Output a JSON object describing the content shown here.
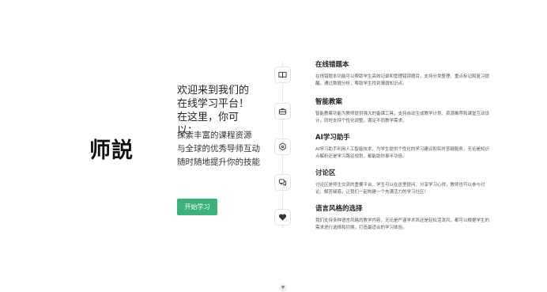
{
  "logo": {
    "text": "师説"
  },
  "welcome": {
    "heading": "欢迎来到我们的在线学习平台！在这里，你可以："
  },
  "features": [
    "探索丰富的课程资源",
    "与全球的优秀导师互动",
    "随时随地提升你的技能"
  ],
  "start_button": {
    "label": "开始学习",
    "color": "#3bb27a"
  },
  "timeline": {
    "icons": [
      "book-icon",
      "briefcase-icon",
      "ai-icon",
      "chat-icon",
      "heart-icon"
    ]
  },
  "sections": [
    {
      "title": "在线错题本",
      "desc": "在线错题本功能可以帮助学生高效记录和管理错误题目，支持分类整理、重点标记和复习提醒。通过数据分析，帮助学生找到薄弱知识点。"
    },
    {
      "title": "智能教案",
      "desc": "智能教案功能为教师提供强大的备课工具，支持自动生成教学计划、资源推荐和课堂互动设计，同时支持个性化调整，满足不同教学需求。"
    },
    {
      "title": "AI学习助手",
      "desc": "AI学习助手利用人工智能技术，为学生提供个性化的学习建议和实时答疑服务，无论是知识点解析还是学习路径规划，都能助你事半功倍。"
    },
    {
      "title": "讨论区",
      "desc": "讨论区是师生交流的重要平台，学生可以在这里提问、分享学习心得，教师也可以参与讨论，解答疑惑，让我们一起构建一个充满活力的学习社区！"
    },
    {
      "title": "语言风格的选择",
      "desc": "我们支持多种语言风格的教学内容，无论是严谨学术风还是轻松活泼风，都可以根据学生的需求进行选择和切换，打造最适合的学习体验。"
    }
  ],
  "scroll": {
    "icon": "chevron-down-icon",
    "glyph": "▼"
  }
}
